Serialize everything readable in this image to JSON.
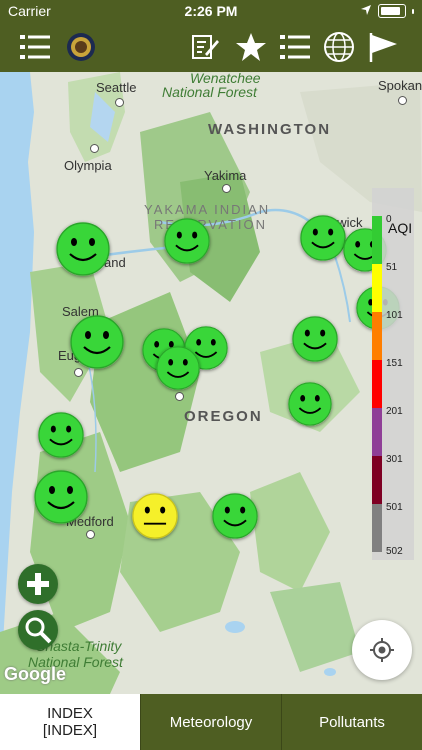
{
  "status": {
    "carrier": "Carrier",
    "time": "2:26 PM"
  },
  "toolbar": {
    "icons": [
      "list-icon",
      "seal-logo",
      "edit-icon",
      "star-icon",
      "list-icon",
      "globe-icon",
      "flag-icon"
    ]
  },
  "map": {
    "labels": {
      "forest_wenatchee": "National Forest",
      "forest_wenatchee_top": "Wenatchee",
      "washington": "WASHINGTON",
      "oregon": "OREGON",
      "yakama": "YAKAMA INDIAN",
      "reservation": "RESERVATION",
      "seattle": "Seattle",
      "olympia": "Olympia",
      "yakima": "Yakima",
      "kennewick": "ewick",
      "spokane": "Spokan",
      "portland": "and",
      "salem": "Salem",
      "eugene": "Eugene",
      "medford": "Medford",
      "shasta1": "Shasta-Trinity",
      "shasta2": "National Forest"
    },
    "markers_good_count": 13,
    "markers_moderate_count": 1,
    "google": "Google"
  },
  "legend": {
    "title": "AQI",
    "ticks": [
      "0",
      "51",
      "101",
      "151",
      "201",
      "301",
      "501",
      "502"
    ],
    "colors": [
      "#33cc33",
      "#ffff00",
      "#ff7e00",
      "#ff0000",
      "#8f3f97",
      "#7e0023",
      "#808080"
    ]
  },
  "tabs": [
    {
      "label": "INDEX\n[INDEX]"
    },
    {
      "label": "Meteorology"
    },
    {
      "label": "Pollutants"
    }
  ]
}
